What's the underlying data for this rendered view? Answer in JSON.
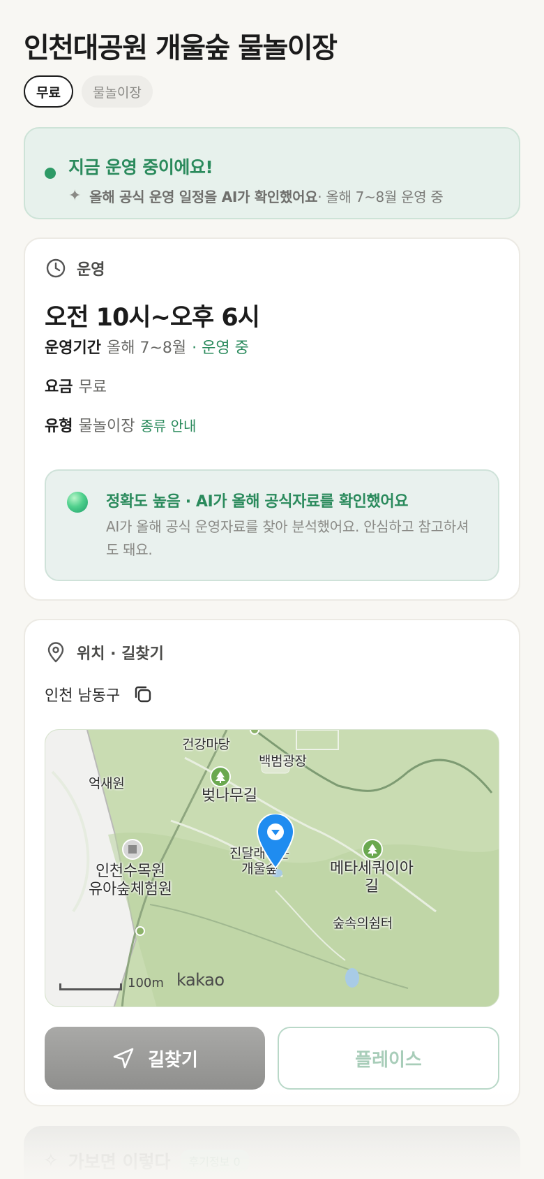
{
  "header": {
    "title": "인천대공원 개울숲 물놀이장",
    "chips": [
      "무료",
      "물놀이장"
    ]
  },
  "status": {
    "title": "지금 운영 중이에요!",
    "sub_bold": "올해 공식 운영 일정을 AI가 확인했어요",
    "sub_rest": " · 올해 7~8월 운영 중",
    "icon": "sparkle-icon"
  },
  "hours": {
    "section_label": "운영",
    "icon": "clock-icon",
    "main": "오전 10시~오후 6시",
    "period_key": "운영기간",
    "period_value": "올해 7~8월",
    "period_status": "· 운영 중",
    "fee_key": "요금",
    "fee_value": "무료",
    "type_key": "유형",
    "type_value": "물놀이장",
    "type_link": "종류 안내",
    "ai_title": "정확도 높음 · AI가 올해 공식자료를 확인했어요",
    "ai_desc": "AI가 올해 공식 운영자료를 찾아 분석했어요. 안심하고 참고하셔도 돼요."
  },
  "location": {
    "section_label": "위치 · 길찾기",
    "icon": "location-pin-icon",
    "address": "인천 남동구",
    "copy_icon": "copy-icon",
    "map": {
      "labels": {
        "health": "건강마당",
        "baekbeom": "백범광장",
        "eoksae": "억새원",
        "cherry": "벚나무길",
        "azalea": "진달래피는\n개울숲",
        "metasequoia": "메타세쿼이아\n길",
        "arboretum": "인천수목원\n유아숲체험원",
        "rest": "숲속의쉼터"
      },
      "scale": "100m",
      "brand": "kakao"
    },
    "route_label": "길찾기",
    "place_label": "플레이스"
  },
  "next_section": {
    "title": "가보면 이렇다",
    "badge": "후기정보 0"
  },
  "colors": {
    "accent_green": "#2a8a5c",
    "background": "#f8f7f3",
    "status_bg": "#e7f1ec"
  }
}
